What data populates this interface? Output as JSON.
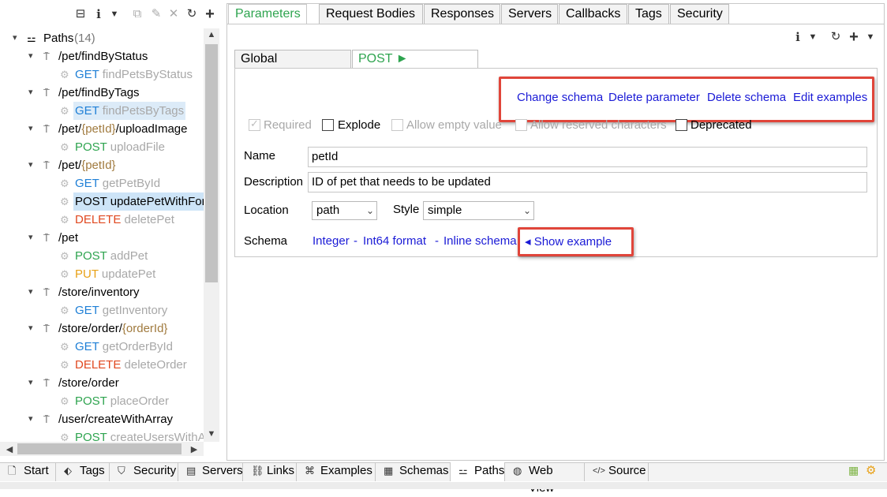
{
  "left_toolbar": {
    "collapse_icon": "collapse-icon",
    "info_icon": "info-icon",
    "copy_icon": "copy-icon",
    "edit_icon": "edit-icon",
    "delete_icon": "delete-icon",
    "refresh_icon": "refresh-icon",
    "add_icon": "plus-icon"
  },
  "tree": {
    "root_label": "Paths",
    "root_count": "(14)",
    "rows": [
      {
        "type": "path",
        "parts": [
          "/pet/findByStatus"
        ]
      },
      {
        "type": "op",
        "method": "GET",
        "name": "findPetsByStatus"
      },
      {
        "type": "path",
        "parts": [
          "/pet/findByTags"
        ]
      },
      {
        "type": "op",
        "method": "GET",
        "name": "findPetsByTags"
      },
      {
        "type": "path",
        "parts": [
          "/pet/",
          "{petId}",
          "/uploadImage"
        ]
      },
      {
        "type": "op",
        "method": "POST",
        "name": "uploadFile"
      },
      {
        "type": "path",
        "parts": [
          "/pet/",
          "{petId}",
          ""
        ]
      },
      {
        "type": "op",
        "method": "GET",
        "name": "getPetById"
      },
      {
        "type": "op",
        "method": "POST",
        "name": "updatePetWithForm"
      },
      {
        "type": "op",
        "method": "DELETE",
        "name": "deletePet"
      },
      {
        "type": "path",
        "parts": [
          "/pet"
        ]
      },
      {
        "type": "op",
        "method": "POST",
        "name": "addPet"
      },
      {
        "type": "op",
        "method": "PUT",
        "name": "updatePet"
      },
      {
        "type": "path",
        "parts": [
          "/store/inventory"
        ]
      },
      {
        "type": "op",
        "method": "GET",
        "name": "getInventory"
      },
      {
        "type": "path",
        "parts": [
          "/store/order/",
          "{orderId}",
          ""
        ]
      },
      {
        "type": "op",
        "method": "GET",
        "name": "getOrderById"
      },
      {
        "type": "op",
        "method": "DELETE",
        "name": "deleteOrder"
      },
      {
        "type": "path",
        "parts": [
          "/store/order"
        ]
      },
      {
        "type": "op",
        "method": "POST",
        "name": "placeOrder"
      },
      {
        "type": "path",
        "parts": [
          "/user/createWithArray"
        ]
      },
      {
        "type": "op",
        "method": "POST",
        "name": "createUsersWithArrayInput"
      }
    ]
  },
  "top_tabs": [
    "Parameters",
    "Request Bodies",
    "Responses",
    "Servers",
    "Callbacks",
    "Tags",
    "Security"
  ],
  "inner_tabs": {
    "global": "Global Parameters",
    "operation": "POST ► /pet/{petId}"
  },
  "actions": {
    "change_schema": "Change schema",
    "delete_parameter": "Delete parameter",
    "delete_schema": "Delete schema",
    "edit_examples": "Edit examples"
  },
  "checkboxes": {
    "required": "Required",
    "explode": "Explode",
    "allow_empty": "Allow empty value",
    "allow_reserved": "Allow reserved characters",
    "deprecated": "Deprecated"
  },
  "form": {
    "name_label": "Name",
    "name_value": "petId",
    "description_label": "Description",
    "description_value": "ID of pet that needs to be updated",
    "location_label": "Location",
    "location_value": "path",
    "style_label": "Style",
    "style_value": "simple",
    "schema_label": "Schema",
    "schema_type": "Integer",
    "schema_sep1": "-",
    "schema_format": "Int64 format",
    "schema_sep2": "-",
    "schema_inline": "Inline schema",
    "show_example": "◂ Show example"
  },
  "bottom_tabs": [
    "Start",
    "Tags",
    "Security",
    "Servers",
    "Links",
    "Examples",
    "Schemas",
    "Paths",
    "Web View",
    "Source"
  ],
  "colors": {
    "get": "#1e7fd6",
    "post": "#2ea44f",
    "put": "#e8a117",
    "delete": "#e0481f",
    "highlight": "#e0453a",
    "link": "#1a1ad6"
  }
}
